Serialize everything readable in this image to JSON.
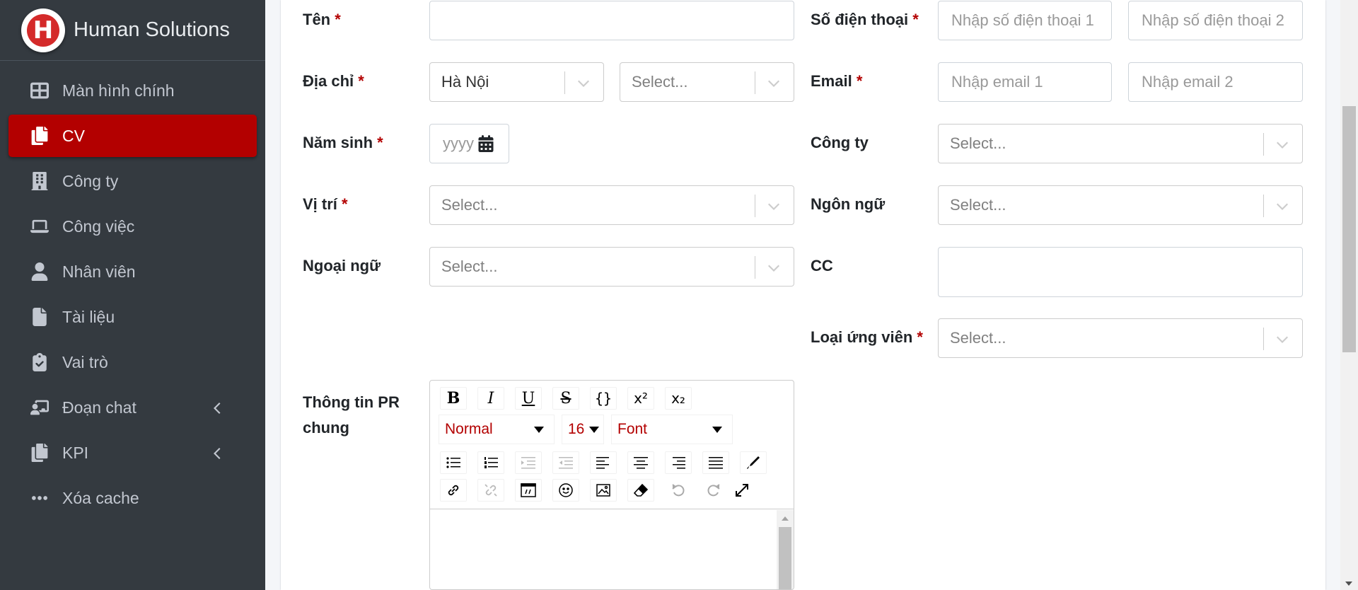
{
  "brand": {
    "logo_letter": "H",
    "name": "Human Solutions"
  },
  "sidebar": {
    "items": [
      {
        "label": "Màn hình chính",
        "icon": "dashboard-icon"
      },
      {
        "label": "CV",
        "icon": "copy-icon",
        "active": true
      },
      {
        "label": "Công ty",
        "icon": "building-icon"
      },
      {
        "label": "Công việc",
        "icon": "laptop-icon"
      },
      {
        "label": "Nhân viên",
        "icon": "user-icon"
      },
      {
        "label": "Tài liệu",
        "icon": "file-icon"
      },
      {
        "label": "Vai trò",
        "icon": "clipboard-check-icon"
      },
      {
        "label": "Đoạn chat",
        "icon": "chalkboard-user-icon",
        "has_submenu": true
      },
      {
        "label": "KPI",
        "icon": "copy-icon",
        "has_submenu": true
      },
      {
        "label": "Xóa cache",
        "icon": "ellipsis-icon"
      }
    ]
  },
  "form": {
    "required_mark": "*",
    "ten": {
      "label": "Tên",
      "value": ""
    },
    "dia_chi": {
      "label": "Địa chỉ",
      "city": "Hà Nội",
      "district_placeholder": "Select..."
    },
    "nam_sinh": {
      "label": "Năm sinh",
      "placeholder": "yyyy"
    },
    "vi_tri": {
      "label": "Vị trí",
      "placeholder": "Select..."
    },
    "ngoai_ngu": {
      "label": "Ngoại ngữ",
      "placeholder": "Select..."
    },
    "so_dien_thoai": {
      "label": "Số điện thoại",
      "placeholder1": "Nhập số điện thoại 1",
      "placeholder2": "Nhập số điện thoại 2"
    },
    "email": {
      "label": "Email",
      "placeholder1": "Nhập email 1",
      "placeholder2": "Nhập email 2"
    },
    "cong_ty": {
      "label": "Công ty",
      "placeholder": "Select..."
    },
    "ngon_ngu": {
      "label": "Ngôn ngữ",
      "placeholder": "Select..."
    },
    "cc": {
      "label": "CC",
      "value": ""
    },
    "loai_ung_vien": {
      "label": "Loại ứng viên",
      "placeholder": "Select..."
    },
    "thong_tin_pr": {
      "label_line1": "Thông tin PR",
      "label_line2": "chung"
    }
  },
  "editor": {
    "style_dropdown": "Normal",
    "size_dropdown": "16",
    "font_dropdown": "Font",
    "format_buttons": [
      "B",
      "I",
      "U",
      "S",
      "{}",
      "x²",
      "x₂"
    ],
    "accent_color": "#b30000"
  },
  "colors": {
    "sidebar_bg": "#343a40",
    "active_bg": "#b30000",
    "required": "#b30000"
  }
}
